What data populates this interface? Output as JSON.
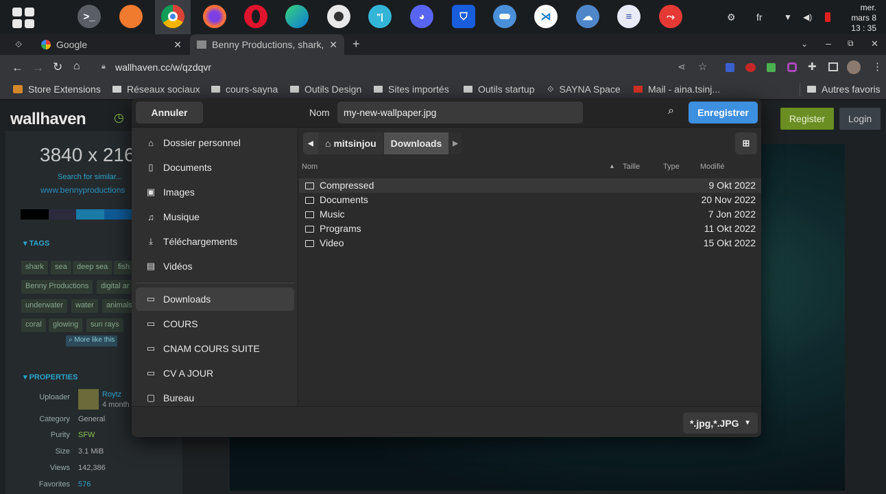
{
  "taskbar": {
    "apps": [
      "launcher-icon",
      "terminal-icon",
      "files-icon",
      "chrome-icon",
      "firefox-icon",
      "opera-icon",
      "edge-icon",
      "obs-icon",
      "vlc-icon",
      "discord-icon",
      "bitwarden-icon",
      "switcher-icon",
      "vscode-icon",
      "cloud-icon",
      "notes-icon",
      "pdf-icon"
    ],
    "lang": "fr",
    "clock": {
      "day": "mer.",
      "date": "mars 8",
      "time": "13 : 35"
    }
  },
  "browser": {
    "tabs": [
      {
        "label": "Google"
      },
      {
        "label": "Benny Productions, shark,"
      }
    ],
    "new_tab": "+",
    "url": "wallhaven.cc/w/qzdqvr",
    "bookmarks": [
      "Store Extensions",
      "Réseaux sociaux",
      "cours-sayna",
      "Outils Design",
      "Sites importés",
      "Outils startup",
      "SAYNA Space",
      "Mail - aina.tsinj...",
      "Autres favoris"
    ]
  },
  "page": {
    "logo": "wallhaven",
    "resolution": "3840 x 216",
    "search_similar": "Search for similar...",
    "source": "www.bennyproductions",
    "register": "Register",
    "login": "Login",
    "tags_title": "TAGS",
    "tags": [
      "shark",
      "sea",
      "deep sea",
      "fish",
      "Benny Productions",
      "digital ar",
      "underwater",
      "water",
      "animals",
      "coral",
      "glowing",
      "sun rays"
    ],
    "more_like": "More like this",
    "props_title": "PROPERTIES",
    "props": [
      {
        "label": "Uploader",
        "value": "Roytz"
      },
      {
        "label": "Category",
        "value": "General"
      },
      {
        "label": "Purity",
        "value": "SFW"
      },
      {
        "label": "Size",
        "value": "3.1 MiB"
      },
      {
        "label": "Views",
        "value": "142,386"
      },
      {
        "label": "Favorites",
        "value": "576"
      }
    ],
    "uploader_time": "4 month",
    "palette": [
      "#000000",
      "#2d2a3e",
      "#1a7aa8",
      "#0f5a96"
    ]
  },
  "dialog": {
    "cancel": "Annuler",
    "name_label": "Nom",
    "filename": "my-new-wallpaper.jpg",
    "save": "Enregistrer",
    "places": [
      {
        "icon": "home-icon",
        "label": "Dossier personnel"
      },
      {
        "icon": "document-icon",
        "label": "Documents"
      },
      {
        "icon": "image-icon",
        "label": "Images"
      },
      {
        "icon": "music-icon",
        "label": "Musique"
      },
      {
        "icon": "download-icon",
        "label": "Téléchargements"
      },
      {
        "icon": "video-icon",
        "label": "Vidéos"
      }
    ],
    "bookmarks": [
      {
        "label": "Downloads",
        "selected": true
      },
      {
        "label": "COURS"
      },
      {
        "label": "CNAM COURS SUITE"
      },
      {
        "label": "CV A JOUR"
      },
      {
        "label": "Bureau"
      }
    ],
    "path": [
      "mitsinjou",
      "Downloads"
    ],
    "columns": {
      "name": "Nom",
      "size": "Taille",
      "type": "Type",
      "modified": "Modifié"
    },
    "files": [
      {
        "name": "Compressed",
        "modified": "9 Okt 2022"
      },
      {
        "name": "Documents",
        "modified": "20 Nov 2022"
      },
      {
        "name": "Music",
        "modified": "7 Jon 2022"
      },
      {
        "name": "Programs",
        "modified": "11 Okt 2022"
      },
      {
        "name": "Video",
        "modified": "15 Okt 2022"
      }
    ],
    "filter": "*.jpg,*.JPG"
  }
}
